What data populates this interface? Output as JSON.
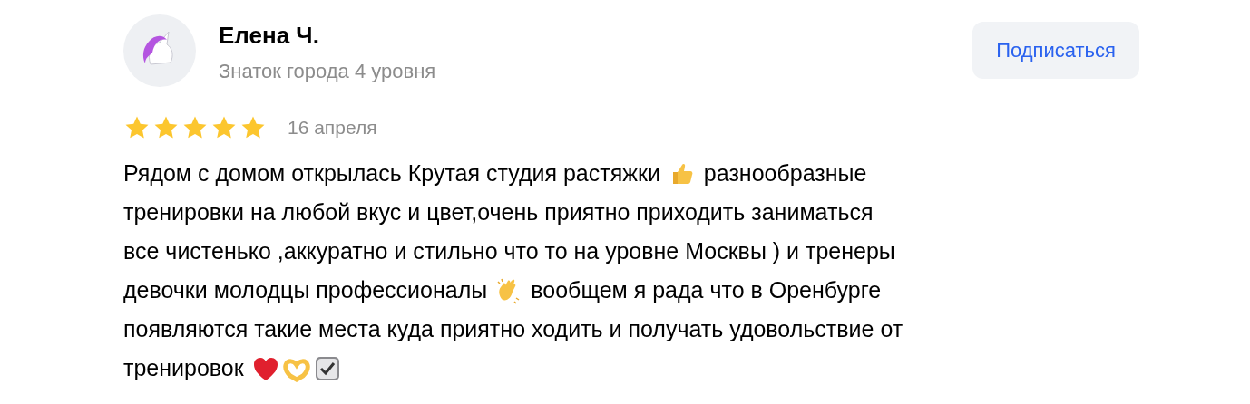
{
  "author": {
    "name": "Елена Ч.",
    "subtitle": "Знаток города 4 уровня"
  },
  "subscribe_button": {
    "label": "Подписаться"
  },
  "review": {
    "stars": 5,
    "date": "16 апреля",
    "lines": [
      [
        {
          "kind": "text",
          "text": "Рядом с домом открылась Крутая студия растяжки"
        },
        {
          "kind": "thumbs-up"
        },
        {
          "kind": "text",
          "text": "разнообразные"
        }
      ],
      [
        {
          "kind": "text",
          "text": "тренировки на любой вкус и цвет,очень приятно приходить заниматься"
        }
      ],
      [
        {
          "kind": "text",
          "text": "все чистенько ,аккуратно и стильно что то на уровне Москвы ) и тренеры"
        }
      ],
      [
        {
          "kind": "text",
          "text": "девочки молодцы профессионалы"
        },
        {
          "kind": "clap"
        },
        {
          "kind": "text",
          "text": "вообщем я рада что в Оренбурге"
        }
      ],
      [
        {
          "kind": "text",
          "text": "появляются такие места куда приятно ходить и получать удовольствие от"
        }
      ],
      [
        {
          "kind": "text",
          "text": "тренировок"
        },
        {
          "kind": "heart"
        },
        {
          "kind": "hands-heart"
        },
        {
          "kind": "check-box"
        }
      ]
    ]
  }
}
